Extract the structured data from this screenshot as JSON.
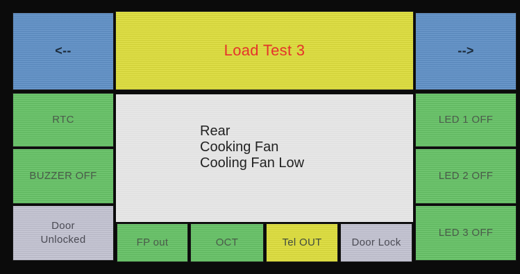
{
  "header": {
    "back_label": "<--",
    "title": "Load Test 3",
    "forward_label": "-->"
  },
  "left_buttons": {
    "rtc": "RTC",
    "buzzer": "BUZZER OFF",
    "door_status_line1": "Door",
    "door_status_line2": "Unlocked"
  },
  "right_buttons": {
    "led1": "LED 1 OFF",
    "led2": "LED 2 OFF",
    "led3": "LED 3 OFF"
  },
  "display": {
    "lines": [
      "Rear",
      "Cooking Fan",
      "Cooling Fan Low"
    ]
  },
  "bottom_buttons": {
    "fp_out": "FP out",
    "oct": "OCT",
    "tel_out": "Tel OUT",
    "door_lock": "Door Lock"
  },
  "colors": {
    "blue": "#5f90c7",
    "yellow": "#dede3c",
    "green": "#66c266",
    "gray": "#c4c4d2",
    "title_red": "#e5332b",
    "display_bg": "#e7e7e7"
  }
}
